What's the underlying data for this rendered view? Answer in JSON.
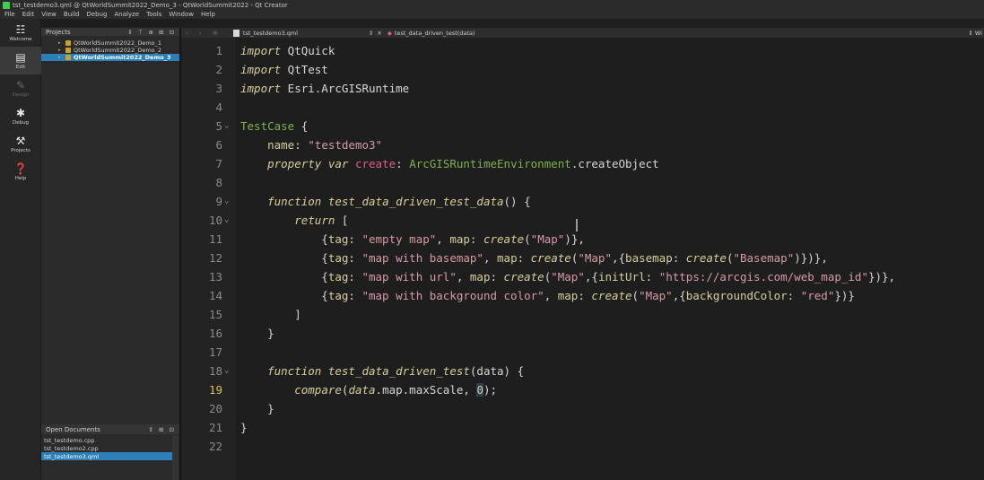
{
  "window": {
    "title": "tst_testdemo3.qml @ QtWorldSummit2022_Demo_3 - QtWorldSummit2022 - Qt Creator"
  },
  "menu": [
    "File",
    "Edit",
    "View",
    "Build",
    "Debug",
    "Analyze",
    "Tools",
    "Window",
    "Help"
  ],
  "modes": [
    {
      "label": "Welcome",
      "icon": "grid-icon",
      "glyph": "☷",
      "active": false,
      "enabled": true
    },
    {
      "label": "Edit",
      "icon": "edit-document-icon",
      "glyph": "▤",
      "active": true,
      "enabled": true
    },
    {
      "label": "Design",
      "icon": "pencil-icon",
      "glyph": "✎",
      "active": false,
      "enabled": false
    },
    {
      "label": "Debug",
      "icon": "bug-icon",
      "glyph": "✱",
      "active": false,
      "enabled": true
    },
    {
      "label": "Projects",
      "icon": "wrench-icon",
      "glyph": "⚒",
      "active": false,
      "enabled": true
    },
    {
      "label": "Help",
      "icon": "help-icon",
      "glyph": "❓",
      "active": false,
      "enabled": true
    }
  ],
  "projects": {
    "header": "Projects",
    "tools": "⇕ ⊤ ⊕ ⊞ ⊡",
    "items": [
      {
        "label": "QtWorldSummit2022_Demo_1",
        "selected": false
      },
      {
        "label": "QtWorldSummit2022_Demo_2",
        "selected": false
      },
      {
        "label": "QtWorldSummit2022_Demo_3",
        "selected": true
      }
    ]
  },
  "open_documents": {
    "header": "Open Documents",
    "tools": "⇕ ⊞ ⊡",
    "items": [
      {
        "label": "tst_testdemo.cpp",
        "selected": false
      },
      {
        "label": "tst_testdemo2.cpp",
        "selected": false
      },
      {
        "label": "tst_testdemo3.qml",
        "selected": true
      }
    ]
  },
  "editor_toolbar": {
    "nav": "‹ › ⊕",
    "document": "tst_testdemo3.qml",
    "arrows": "⇕",
    "close": "✕",
    "symbol": "test_data_driven_test(data)",
    "right": "⇕ Wi"
  },
  "editor": {
    "current_line": 19,
    "line_numbers": [
      "1",
      "2",
      "3",
      "4",
      "5",
      "6",
      "7",
      "8",
      "9",
      "10",
      "11",
      "12",
      "13",
      "14",
      "15",
      "16",
      "17",
      "18",
      "19",
      "20",
      "21",
      "22"
    ],
    "fold_markers": {
      "5": "⌄",
      "9": "⌄",
      "10": "⌄",
      "18": "⌄"
    },
    "lines": [
      [
        {
          "c": "kw",
          "t": "import"
        },
        {
          "c": "ident",
          "t": " QtQuick"
        }
      ],
      [
        {
          "c": "kw",
          "t": "import"
        },
        {
          "c": "ident",
          "t": " QtTest"
        }
      ],
      [
        {
          "c": "kw",
          "t": "import"
        },
        {
          "c": "ident",
          "t": " Esri.ArcGISRuntime"
        }
      ],
      [],
      [
        {
          "c": "type",
          "t": "TestCase"
        },
        {
          "c": "ident",
          "t": " {"
        }
      ],
      [
        {
          "c": "ident",
          "t": "    "
        },
        {
          "c": "prop",
          "t": "name"
        },
        {
          "c": "ident",
          "t": ": "
        },
        {
          "c": "str",
          "t": "\"testdemo3\""
        }
      ],
      [
        {
          "c": "ident",
          "t": "    "
        },
        {
          "c": "kw",
          "t": "property"
        },
        {
          "c": "ident",
          "t": " "
        },
        {
          "c": "kw",
          "t": "var"
        },
        {
          "c": "ident",
          "t": " "
        },
        {
          "c": "pink",
          "t": "create"
        },
        {
          "c": "ident",
          "t": ": "
        },
        {
          "c": "type",
          "t": "ArcGISRuntimeEnvironment"
        },
        {
          "c": "ident",
          "t": ".createObject"
        }
      ],
      [],
      [
        {
          "c": "ident",
          "t": "    "
        },
        {
          "c": "kw",
          "t": "function"
        },
        {
          "c": "ident",
          "t": " "
        },
        {
          "c": "fn",
          "t": "test_data_driven_test_data"
        },
        {
          "c": "ident",
          "t": "() {"
        }
      ],
      [
        {
          "c": "ident",
          "t": "        "
        },
        {
          "c": "kw",
          "t": "return"
        },
        {
          "c": "ident",
          "t": " ["
        }
      ],
      [
        {
          "c": "ident",
          "t": "            {"
        },
        {
          "c": "prop",
          "t": "tag"
        },
        {
          "c": "ident",
          "t": ": "
        },
        {
          "c": "str",
          "t": "\"empty map\""
        },
        {
          "c": "ident",
          "t": ", "
        },
        {
          "c": "prop",
          "t": "map"
        },
        {
          "c": "ident",
          "t": ": "
        },
        {
          "c": "fn",
          "t": "create"
        },
        {
          "c": "ident",
          "t": "("
        },
        {
          "c": "str",
          "t": "\"Map\""
        },
        {
          "c": "ident",
          "t": ")},"
        }
      ],
      [
        {
          "c": "ident",
          "t": "            {"
        },
        {
          "c": "prop",
          "t": "tag"
        },
        {
          "c": "ident",
          "t": ": "
        },
        {
          "c": "str",
          "t": "\"map with basemap\""
        },
        {
          "c": "ident",
          "t": ", "
        },
        {
          "c": "prop",
          "t": "map"
        },
        {
          "c": "ident",
          "t": ": "
        },
        {
          "c": "fn",
          "t": "create"
        },
        {
          "c": "ident",
          "t": "("
        },
        {
          "c": "str",
          "t": "\"Map\""
        },
        {
          "c": "ident",
          "t": ",{"
        },
        {
          "c": "prop",
          "t": "basemap"
        },
        {
          "c": "ident",
          "t": ": "
        },
        {
          "c": "fn",
          "t": "create"
        },
        {
          "c": "ident",
          "t": "("
        },
        {
          "c": "str",
          "t": "\"Basemap\""
        },
        {
          "c": "ident",
          "t": ")})},"
        }
      ],
      [
        {
          "c": "ident",
          "t": "            {"
        },
        {
          "c": "prop",
          "t": "tag"
        },
        {
          "c": "ident",
          "t": ": "
        },
        {
          "c": "str",
          "t": "\"map with url\""
        },
        {
          "c": "ident",
          "t": ", "
        },
        {
          "c": "prop",
          "t": "map"
        },
        {
          "c": "ident",
          "t": ": "
        },
        {
          "c": "fn",
          "t": "create"
        },
        {
          "c": "ident",
          "t": "("
        },
        {
          "c": "str",
          "t": "\"Map\""
        },
        {
          "c": "ident",
          "t": ",{"
        },
        {
          "c": "prop",
          "t": "initUrl"
        },
        {
          "c": "ident",
          "t": ": "
        },
        {
          "c": "str",
          "t": "\"https://arcgis.com/web_map_id\""
        },
        {
          "c": "ident",
          "t": "})},"
        }
      ],
      [
        {
          "c": "ident",
          "t": "            {"
        },
        {
          "c": "prop",
          "t": "tag"
        },
        {
          "c": "ident",
          "t": ": "
        },
        {
          "c": "str",
          "t": "\"map with background color\""
        },
        {
          "c": "ident",
          "t": ", "
        },
        {
          "c": "prop",
          "t": "map"
        },
        {
          "c": "ident",
          "t": ": "
        },
        {
          "c": "fn",
          "t": "create"
        },
        {
          "c": "ident",
          "t": "("
        },
        {
          "c": "str",
          "t": "\"Map\""
        },
        {
          "c": "ident",
          "t": ",{"
        },
        {
          "c": "prop",
          "t": "backgroundColor"
        },
        {
          "c": "ident",
          "t": ": "
        },
        {
          "c": "str",
          "t": "\"red\""
        },
        {
          "c": "ident",
          "t": "})}"
        }
      ],
      [
        {
          "c": "ident",
          "t": "        ]"
        }
      ],
      [
        {
          "c": "ident",
          "t": "    }"
        }
      ],
      [],
      [
        {
          "c": "ident",
          "t": "    "
        },
        {
          "c": "kw",
          "t": "function"
        },
        {
          "c": "ident",
          "t": " "
        },
        {
          "c": "fn",
          "t": "test_data_driven_test"
        },
        {
          "c": "ident",
          "t": "(data) {"
        }
      ],
      [
        {
          "c": "ident",
          "t": "        "
        },
        {
          "c": "fn",
          "t": "compare"
        },
        {
          "c": "ident",
          "t": "("
        },
        {
          "c": "param",
          "t": "data"
        },
        {
          "c": "ident",
          "t": ".map.maxScale, "
        },
        {
          "c": "sel",
          "t": "0"
        },
        {
          "c": "ident",
          "t": ");"
        }
      ],
      [
        {
          "c": "ident",
          "t": "    }"
        }
      ],
      [
        {
          "c": "ident",
          "t": "}"
        }
      ],
      []
    ]
  },
  "colors": {
    "accent": "#2c7fb8",
    "background": "#1e1e1e",
    "type": "#7fb24a",
    "string": "#d69aa5",
    "keyword": "#d6cf9a"
  }
}
